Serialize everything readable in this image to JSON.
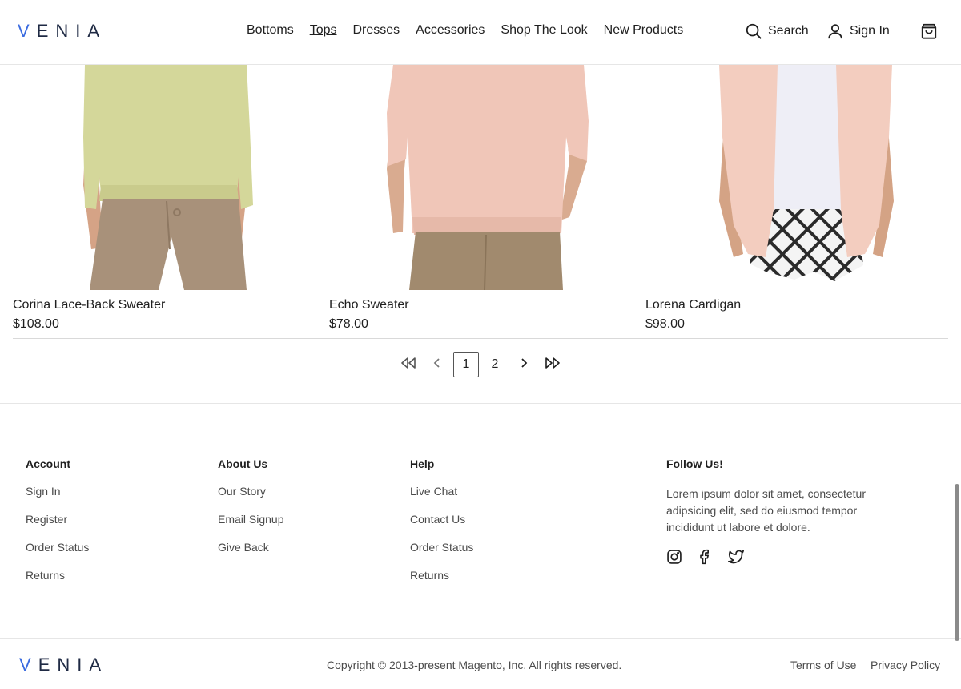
{
  "brand": {
    "logo_first": "V",
    "logo_rest": "ENIA",
    "accent": "#3a6be0"
  },
  "header": {
    "nav": [
      {
        "label": "Bottoms"
      },
      {
        "label": "Tops",
        "active": true
      },
      {
        "label": "Dresses"
      },
      {
        "label": "Accessories"
      },
      {
        "label": "Shop The Look"
      },
      {
        "label": "New Products"
      }
    ],
    "search_label": "Search",
    "signin_label": "Sign In",
    "cart_icon": "shopping-bag-icon"
  },
  "products": [
    {
      "name": "Corina Lace-Back Sweater",
      "price": "$108.00",
      "top_color": "#d4d79a",
      "bottom_color": "#a8917a"
    },
    {
      "name": "Echo Sweater",
      "price": "$78.00",
      "top_color": "#f0c6b8",
      "bottom_color": "#a18a6e"
    },
    {
      "name": "Lorena Cardigan",
      "price": "$98.00",
      "top_color": "#f3cdbf",
      "bottom_color": "#2b2b2b"
    }
  ],
  "pagination": {
    "pages": [
      "1",
      "2"
    ],
    "current": "1"
  },
  "footer": {
    "account": {
      "title": "Account",
      "links": [
        "Sign In",
        "Register",
        "Order Status",
        "Returns"
      ]
    },
    "about": {
      "title": "About Us",
      "links": [
        "Our Story",
        "Email Signup",
        "Give Back"
      ]
    },
    "help": {
      "title": "Help",
      "links": [
        "Live Chat",
        "Contact Us",
        "Order Status",
        "Returns"
      ]
    },
    "follow": {
      "title": "Follow Us!",
      "text": "Lorem ipsum dolor sit amet, consectetur adipsicing elit, sed do eiusmod tempor incididunt ut labore et dolore.",
      "icons": [
        "instagram-icon",
        "facebook-icon",
        "twitter-icon"
      ]
    },
    "copyright": "Copyright © 2013-present Magento, Inc. All rights reserved.",
    "terms": "Terms of Use",
    "privacy": "Privacy Policy"
  }
}
